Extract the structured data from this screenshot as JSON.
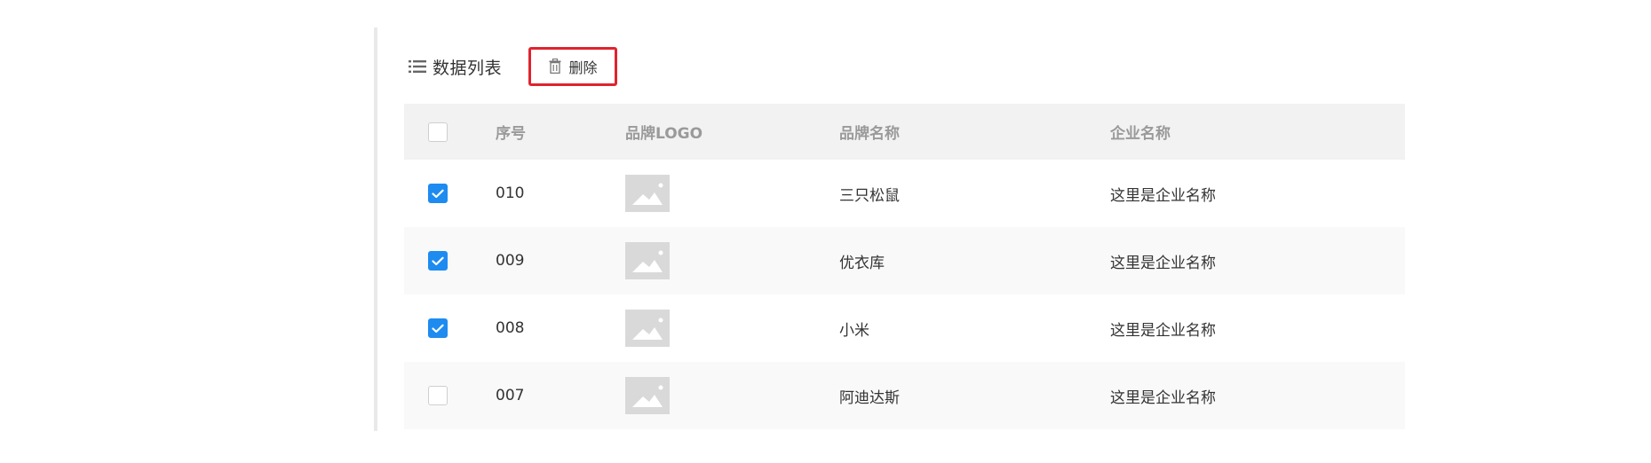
{
  "toolbar": {
    "title": "数据列表",
    "icon": "list-icon",
    "delete_label": "删除",
    "delete_icon": "trash-icon",
    "highlight_color": "#e0232e"
  },
  "table": {
    "headers": {
      "select": "",
      "index": "序号",
      "logo": "品牌LOGO",
      "brand": "品牌名称",
      "company": "企业名称"
    },
    "rows": [
      {
        "index": "010",
        "checked": true,
        "brand": "三只松鼠",
        "company": "这里是企业名称",
        "logo": "image-placeholder-icon"
      },
      {
        "index": "009",
        "checked": true,
        "brand": "优衣库",
        "company": "这里是企业名称",
        "logo": "image-placeholder-icon"
      },
      {
        "index": "008",
        "checked": true,
        "brand": "小米",
        "company": "这里是企业名称",
        "logo": "image-placeholder-icon"
      },
      {
        "index": "007",
        "checked": false,
        "brand": "阿迪达斯",
        "company": "这里是企业名称",
        "logo": "image-placeholder-icon"
      }
    ]
  },
  "colors": {
    "checkbox_checked": "#1e8bf0",
    "header_bg": "#f2f2f2",
    "stripe_bg": "#f9f9f9"
  }
}
